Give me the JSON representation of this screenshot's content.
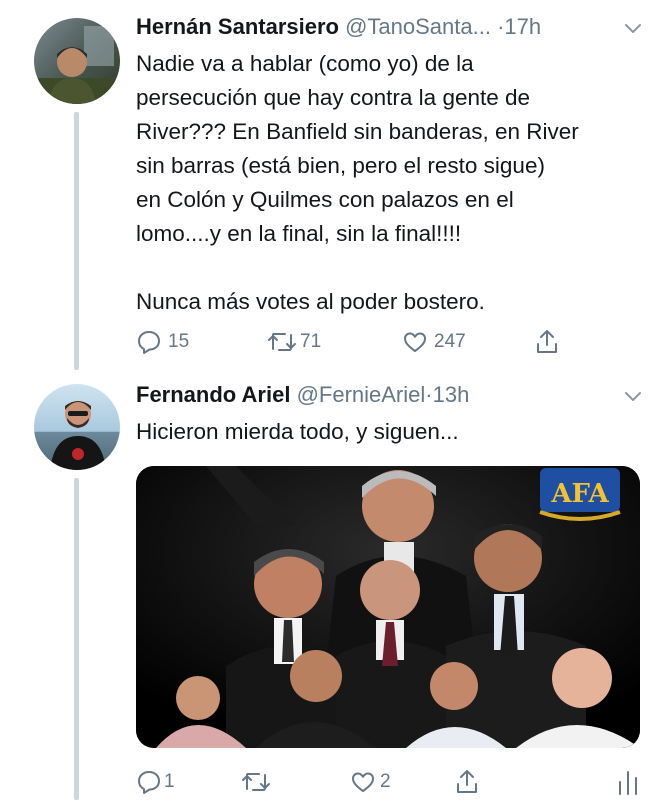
{
  "tweets": [
    {
      "display_name": "Hernán Santarsiero",
      "handle": "@TanoSanta...",
      "time": "17h",
      "text_lines": [
        "Nadie va a hablar (como yo) de la",
        "persecución que hay contra la gente de",
        "River??? En Banfield sin banderas, en River",
        "sin barras (está bien, pero el resto sigue)",
        "en Colón y Quilmes con palazos en el",
        "lomo....y en la final, sin la final!!!!"
      ],
      "text_line_2": "Nunca más votes al poder bostero.",
      "replies": "15",
      "retweets": "71",
      "likes": "247"
    },
    {
      "display_name": "Fernando Ariel",
      "handle": "@FernieAriel",
      "time": "13h",
      "text": "Hicieron mierda todo, y siguen...",
      "media_logo_text": "AFA",
      "replies": "1",
      "retweets": "",
      "likes": "2"
    }
  ],
  "colors": {
    "text": "#14171a",
    "secondary": "#657786",
    "thread_line": "#ccd6dd"
  },
  "icons": [
    "reply-icon",
    "retweet-icon",
    "like-icon",
    "share-icon",
    "analytics-icon",
    "chevron-down-icon"
  ]
}
